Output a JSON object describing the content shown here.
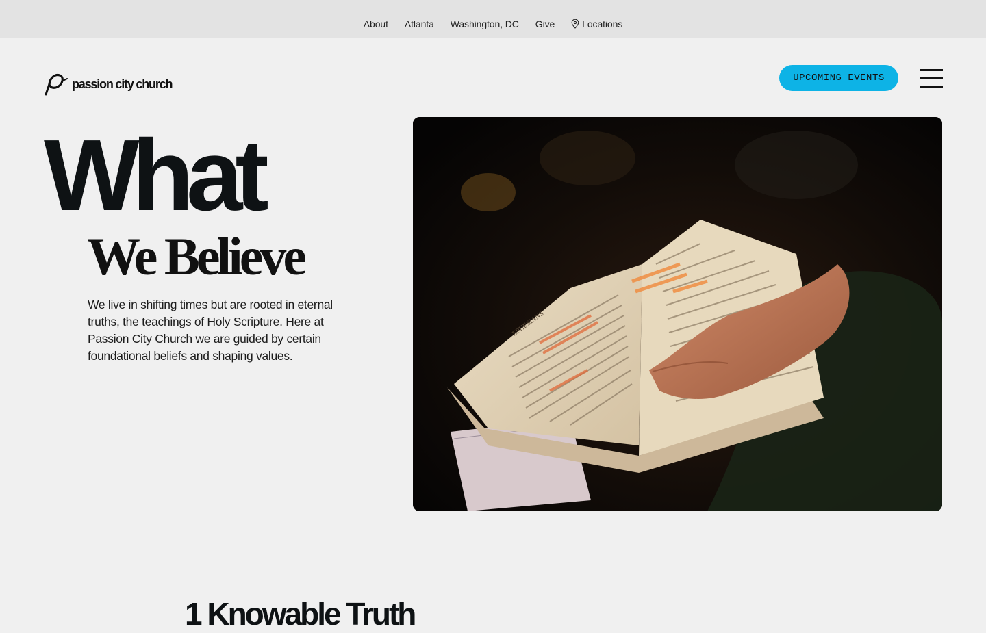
{
  "topnav": {
    "items": [
      {
        "label": "About"
      },
      {
        "label": "Atlanta"
      },
      {
        "label": "Washington, DC"
      },
      {
        "label": "Give"
      },
      {
        "label": "Locations",
        "icon": "map-pin-icon"
      }
    ]
  },
  "header": {
    "logo_text": "passion city church",
    "cta_label": "UPCOMING EVENTS",
    "cta_color": "#0db3e6",
    "menu_icon": "hamburger-menu-icon"
  },
  "hero": {
    "title_line1": "What",
    "title_line2": "We Believe",
    "body": "We live in shifting times but are rooted in eternal truths, the teachings of Holy Scripture. Here at Passion City Church we are guided by certain foundational beliefs and shaping values.",
    "image_page_label": "EPHESIANS"
  },
  "section": {
    "title": "1 Knowable Truth"
  }
}
